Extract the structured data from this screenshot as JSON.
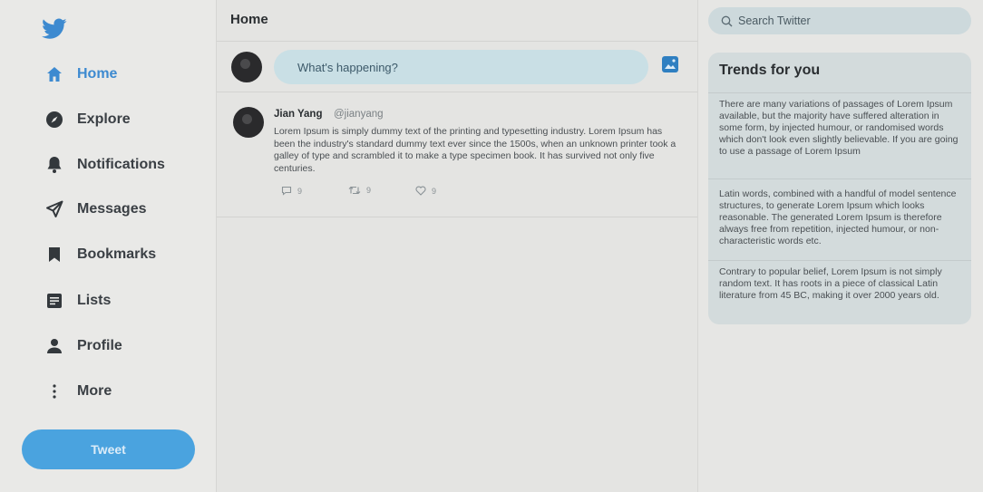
{
  "sidebar": {
    "logo_icon": "twitter-bird-icon",
    "nav": [
      {
        "label": "Home",
        "icon": "home-icon",
        "active": true
      },
      {
        "label": "Explore",
        "icon": "explore-icon"
      },
      {
        "label": "Notifications",
        "icon": "bell-icon"
      },
      {
        "label": "Messages",
        "icon": "paper-plane-icon"
      },
      {
        "label": "Bookmarks",
        "icon": "bookmark-icon"
      },
      {
        "label": "Lists",
        "icon": "list-icon"
      },
      {
        "label": "Profile",
        "icon": "person-icon"
      },
      {
        "label": "More",
        "icon": "more-vertical-icon"
      }
    ],
    "tweet_button": "Tweet"
  },
  "main": {
    "title": "Home",
    "composer": {
      "placeholder": "What's happening?"
    },
    "tweet": {
      "name": "Jian Yang",
      "handle": "@jianyang",
      "text": "Lorem Ipsum is simply dummy text of the printing and typesetting industry. Lorem Ipsum has been the industry's standard dummy text ever since the 1500s, when an unknown printer took a galley of type and scrambled it to make a type specimen book. It has survived not only five centuries.",
      "replies": "9",
      "retweets": "9",
      "likes": "9"
    }
  },
  "right": {
    "search_placeholder": "Search Twitter",
    "trends_title": "Trends for you",
    "trends": [
      "There are many variations of passages of Lorem Ipsum available, but the majority have suffered alteration in some form, by injected humour, or randomised words which don't look even slightly believable. If you are going to use a passage of Lorem Ipsum",
      "Latin words, combined with a handful of model sentence structures, to generate Lorem Ipsum which looks reasonable. The generated Lorem Ipsum is therefore always free from repetition, injected humour, or non-characteristic words etc.",
      "Contrary to popular belief, Lorem Ipsum is not simply random text. It has roots in a piece of classical Latin literature from 45 BC, making it over 2000 years old."
    ]
  },
  "colors": {
    "accent": "#4aa3df",
    "active_nav": "#3d8ad0",
    "background": "#e6e6e4"
  }
}
